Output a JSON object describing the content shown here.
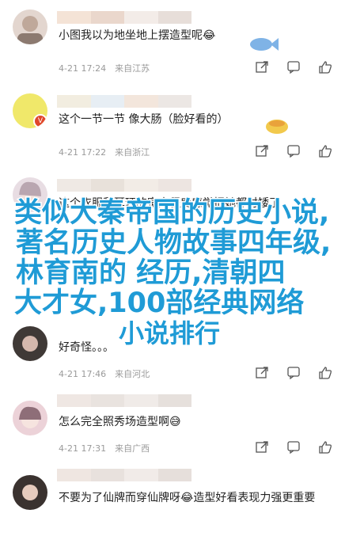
{
  "comments": [
    {
      "text": "小图我以为地坐地上摆造型呢😂",
      "time": "4-21 17:24",
      "loc": "来自江苏",
      "avatar": "#d8cdc6",
      "emoji": "🐟"
    },
    {
      "text": "这个一节一节 像大肠（脸好看的）",
      "time": "4-21 17:22",
      "loc": "来自浙江",
      "avatar": "#e9e04a",
      "emoji": "🍲"
    },
    {
      "text": "这个衣服和耳环的宽大程度感觉把她都衬矮了",
      "time": "",
      "loc": "",
      "avatar": "#d9c7cf",
      "emoji": ""
    },
    {
      "text": "好奇怪。。。",
      "time": "4-21 17:46",
      "loc": "来自河北",
      "avatar": "#3a3533",
      "emoji": ""
    },
    {
      "text": "怎么完全照秀场造型啊😅",
      "time": "4-21 17:31",
      "loc": "来自广西",
      "avatar": "#e8c9cf",
      "emoji": ""
    },
    {
      "text": "不要为了仙牌而穿仙牌呀😂造型好看表现力强更重要",
      "time": "",
      "loc": "",
      "avatar": "#3b3431",
      "emoji": ""
    }
  ],
  "overlay": {
    "line1": "类似大秦帝国的历史小说,",
    "line2": "著名历史人物故事四年级,",
    "line3": "林育南的 经历,清朝四",
    "line4": "大才女,100部经典网络",
    "line5": "小说排行"
  },
  "partial_text": {
    "c3_line2": "把她边走",
    "c3_line2b": "边"
  },
  "icons": {
    "share": "share-icon",
    "comment": "comment-icon",
    "like": "like-icon"
  }
}
